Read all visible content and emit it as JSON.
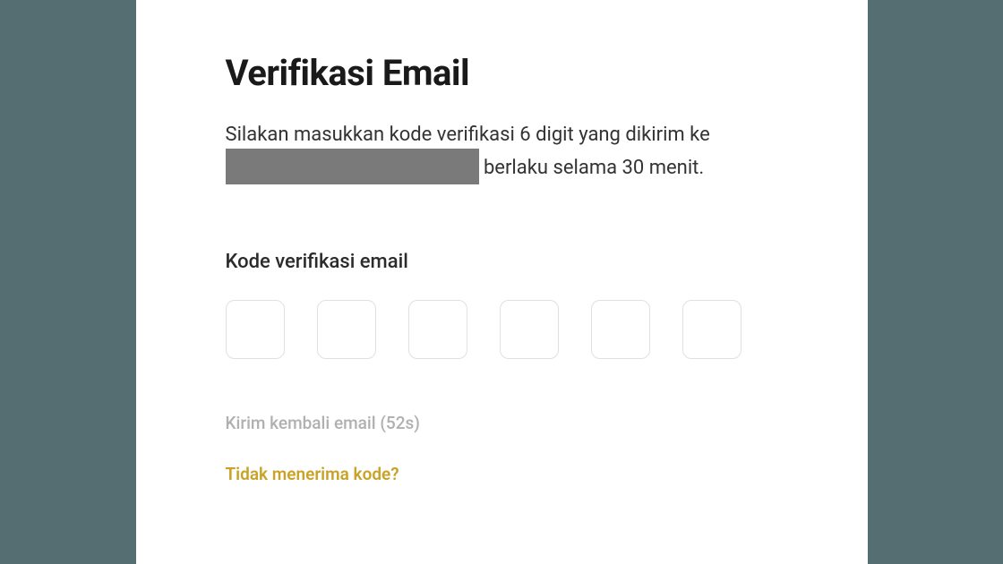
{
  "title": "Verifikasi Email",
  "description": {
    "prefix": "Silakan masukkan kode verifikasi 6 digit yang dikirim ke",
    "suffix_after_redaction": " berlaku selama 30 menit."
  },
  "field_label": "Kode verifikasi email",
  "code": {
    "digits": [
      "",
      "",
      "",
      "",
      "",
      ""
    ]
  },
  "resend": {
    "text_prefix": "Kirim kembali email (",
    "seconds": "52",
    "text_suffix": "s)"
  },
  "help_link": "Tidak menerima kode?",
  "colors": {
    "accent": "#c9a227"
  }
}
